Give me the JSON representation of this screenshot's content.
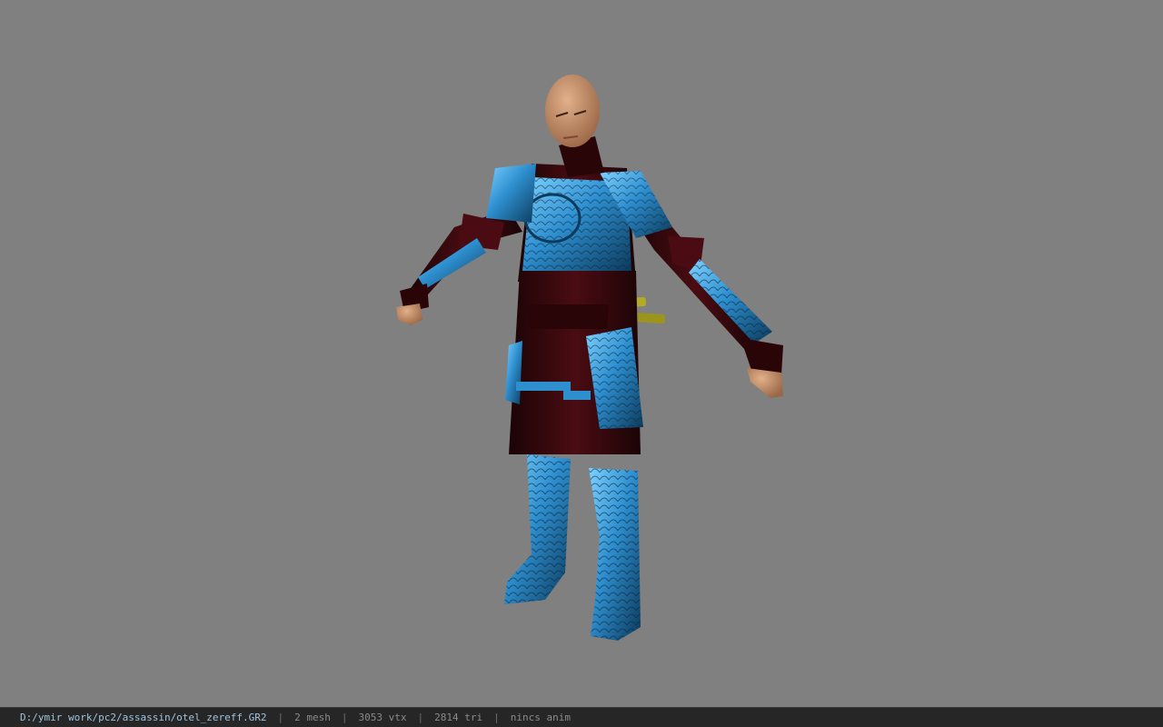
{
  "viewer": {
    "background_color": "#808080",
    "model_name": "otel_zereff",
    "armor_color": "#3aa7e0",
    "cloth_color": "#3a0a0e",
    "skin_color": "#c9946f",
    "weapon_color": "#a9a21f"
  },
  "status": {
    "file_path": "D:/ymir work/pc2/assassin/otel_zereff.GR2",
    "separator": "|",
    "mesh": "2 mesh",
    "vertices": "3053 vtx",
    "triangles": "2814 tri",
    "anim": "nincs anim"
  }
}
